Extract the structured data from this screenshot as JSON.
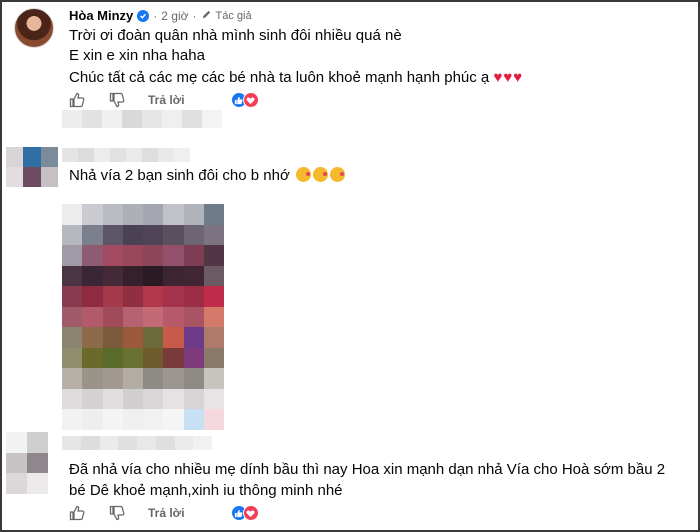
{
  "main_comment": {
    "author": "Hòa Minzy",
    "time": "2 giờ",
    "author_badge": "Tác giả",
    "lines": [
      "Trời ơi đoàn quân nhà mình sinh đôi nhiều quá nè",
      "E xin e xin nha haha",
      "Chúc tất cả các mẹ các bé nhà ta luôn khoẻ mạnh hạnh phúc ạ"
    ],
    "hearts": "♥♥♥",
    "reply_label": "Trả lời"
  },
  "second_comment": {
    "text": "Nhả vía 2 bạn sinh đôi cho b nhớ"
  },
  "third_comment": {
    "lines": [
      "Đã nhả vía cho nhiều mẹ dính bầu thì nay Hoa xin mạnh dạn nhả Vía cho Hoà sớm bầu 2",
      "bé Dê khoẻ mạnh,xinh iu thông minh nhé"
    ],
    "reply_label": "Trả lời"
  },
  "colors": {
    "verified": "#1877f2",
    "heart": "#e41e3f",
    "like": "#1877f2",
    "love": "#f33e58",
    "meta": "#65676b"
  }
}
